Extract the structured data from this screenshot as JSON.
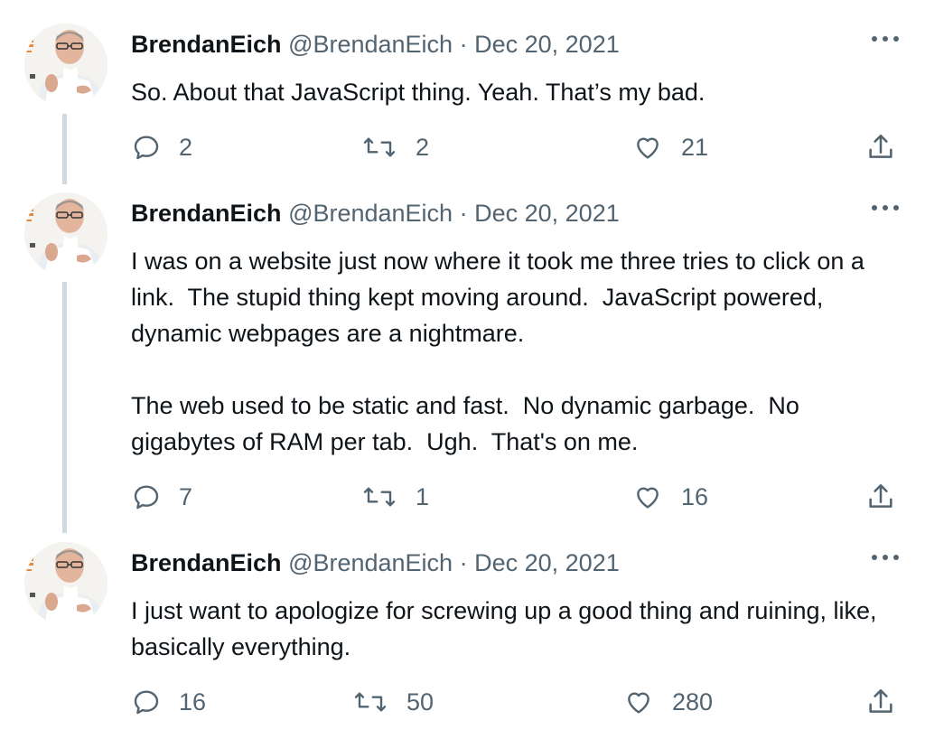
{
  "tweets": [
    {
      "name": "BrendanEich",
      "handle": "@BrendanEich",
      "separator": "·",
      "date": "Dec 20, 2021",
      "paragraphs": [
        "So. About that JavaScript thing. Yeah. That’s my bad."
      ],
      "replies": "2",
      "retweets": "2",
      "likes": "21"
    },
    {
      "name": "BrendanEich",
      "handle": "@BrendanEich",
      "separator": "·",
      "date": "Dec 20, 2021",
      "paragraphs": [
        "I was on a website just now where it took me three tries to click on a link.  The stupid thing kept moving around.  JavaScript powered, dynamic webpages are a nightmare.",
        "The web used to be static and fast.  No dynamic garbage.  No gigabytes of RAM per tab.  Ugh.  That's on me."
      ],
      "replies": "7",
      "retweets": "1",
      "likes": "16"
    },
    {
      "name": "BrendanEich",
      "handle": "@BrendanEich",
      "separator": "·",
      "date": "Dec 20, 2021",
      "paragraphs": [
        "I just want to apologize for screwing up a good thing and ruining, like, basically everything."
      ],
      "replies": "16",
      "retweets": "50",
      "likes": "280"
    }
  ],
  "icons": {
    "reply": "reply-icon",
    "retweet": "retweet-icon",
    "like": "like-icon",
    "share": "share-icon",
    "more": "more-icon"
  },
  "colors": {
    "text": "#0f1419",
    "secondary": "#536471",
    "thread_line": "#cfd9de",
    "background": "#ffffff"
  }
}
